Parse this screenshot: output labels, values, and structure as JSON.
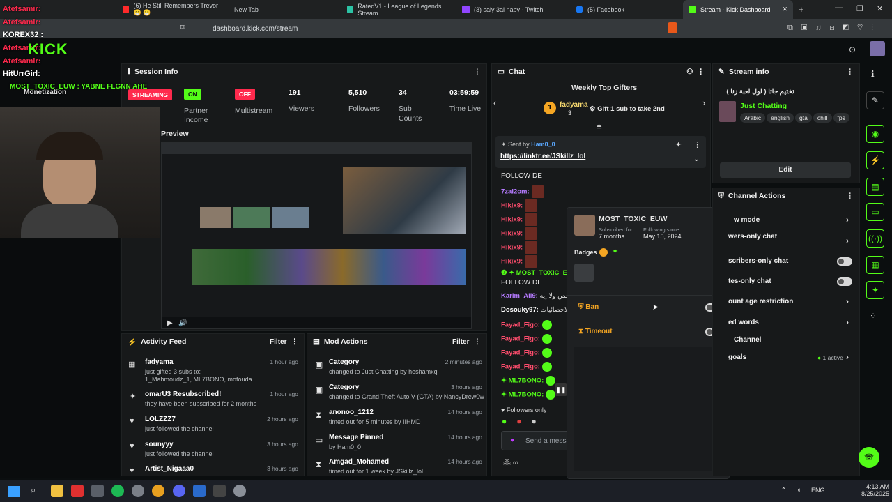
{
  "browser": {
    "tabs": [
      {
        "label": "(6) He Still Remembers Trevor 😁 😁",
        "color": "#ff2a2a"
      },
      {
        "label": "New Tab",
        "color": "#1f2122"
      },
      {
        "label": "RatedV1 - League of Legends Stream",
        "color": "#2cc3a5"
      },
      {
        "label": "(3) saly 3al naby - Twitch",
        "color": "#9146ff"
      },
      {
        "label": "(5) Facebook",
        "color": "#1877f2"
      },
      {
        "label": "Stream - Kick Dashboard",
        "color": "#53fc18"
      }
    ],
    "url": "dashboard.kick.com/stream"
  },
  "overlay": {
    "names": [
      "Atefsamir:",
      "Atefsamir:",
      "KOREX32 :",
      "Atefsamir:",
      "Atefsamir:",
      "HitUrrGirl:"
    ],
    "toxic": "MOST_TOXIC_EUW : YABNE FLGNN AHE",
    "monetization": "Monetization",
    "logo": "KICK"
  },
  "session": {
    "title": "Session Info",
    "streaming": "STREAMING",
    "on": "ON",
    "off": "OFF",
    "partner": "Partner Income",
    "multistream": "Multistream",
    "viewers": {
      "value": "191",
      "label": "Viewers"
    },
    "followers": {
      "value": "5,510",
      "label": "Followers"
    },
    "subs": {
      "value": "34",
      "label": "Sub Counts"
    },
    "time": {
      "value": "03:59:59",
      "label": "Time Live"
    },
    "preview": "Preview"
  },
  "activity": {
    "title": "Activity Feed",
    "filter": "Filter",
    "items": [
      {
        "name": "fadyama",
        "time": "1 hour ago",
        "text": "just gifted 3 subs to:",
        "text2": "1_Mahmoudz_1, ML7BONO, mofouda"
      },
      {
        "name": "omarU3 Resubscribed!",
        "time": "1 hour ago",
        "text": "they have been subscribed for 2 months",
        "text2": ""
      },
      {
        "name": "LOLZZZ7",
        "time": "2 hours ago",
        "text": "just followed the channel",
        "text2": ""
      },
      {
        "name": "sounyyy",
        "time": "3 hours ago",
        "text": "just followed the channel",
        "text2": ""
      },
      {
        "name": "Artist_Nigaaa0",
        "time": "3 hours ago",
        "text": "",
        "text2": ""
      }
    ]
  },
  "mod": {
    "title": "Mod Actions",
    "filter": "Filter",
    "items": [
      {
        "name": "Category",
        "time": "2 minutes ago",
        "text": "changed to Just Chatting by heshamxq"
      },
      {
        "name": "Category",
        "time": "3 hours ago",
        "text": "changed to Grand Theft Auto V (GTA) by NancyDrew0w"
      },
      {
        "name": "anonoo_1212",
        "time": "14 hours ago",
        "text": "timed out for 5 minutes by IIHMD"
      },
      {
        "name": "Message Pinned",
        "time": "14 hours ago",
        "text": "by Ham0_0"
      },
      {
        "name": "Amgad_Mohamed",
        "time": "14 hours ago",
        "text": "timed out for 1 week by JSkillz_lol"
      }
    ]
  },
  "chat": {
    "title": "Chat",
    "gifters_title": "Weekly Top Gifters",
    "gifter": {
      "name": "fadyama",
      "count": "3",
      "cta": "Gift 1 sub to take 2nd"
    },
    "pinned": {
      "sent_by": "Sent by",
      "user": "Ham0_0",
      "link": "https://linktr.ee/JSkillz_lol",
      "follow": "FOLLOW DE"
    },
    "lines": [
      {
        "user": "7zal2om:",
        "color": "#b57bff"
      },
      {
        "user": "Hikix9:",
        "color": "#ff4d6d"
      },
      {
        "user": "Hikix9:",
        "color": "#ff4d6d"
      },
      {
        "user": "Hikix9:",
        "color": "#ff4d6d"
      },
      {
        "user": "Hikix9:",
        "color": "#ff4d6d"
      },
      {
        "user": "Hikix9:",
        "color": "#ff4d6d"
      }
    ],
    "toxic_line": "MOST_TOXIC_E",
    "follow_de": "FOLLOW DE",
    "lines2": [
      {
        "user": "Karim_Ali9:",
        "text": "لو بعض ولا إيه",
        "color": "#b57bff"
      },
      {
        "user": "Dosouky97:",
        "text": "كرة الاحصائيات",
        "color": "#ffffff"
      },
      {
        "user": "Fayad_Figo:",
        "text": "",
        "color": "#ff4d6d"
      },
      {
        "user": "Fayad_Figo:",
        "text": "",
        "color": "#ff4d6d"
      },
      {
        "user": "Fayad_Figo:",
        "text": "",
        "color": "#ff4d6d"
      },
      {
        "user": "Fayad_Figo:",
        "text": "",
        "color": "#ff4d6d"
      },
      {
        "user": "ML7BONO:",
        "text": "",
        "color": "#53fc18"
      },
      {
        "user": "ML7BONO:",
        "text": "",
        "color": "#53fc18"
      }
    ],
    "followers_only": "Followers only",
    "placeholder": "Send a messa"
  },
  "usercard": {
    "name": "MOST_TOXIC_EUW",
    "sub_label": "Subscribed for",
    "sub_value": "7 months",
    "follow_label": "Following since",
    "follow_value": "May 15, 2024",
    "badges": "Badges",
    "ban": "Ban",
    "timeout": "Timeout"
  },
  "streaminfo": {
    "title": "Stream info",
    "stream_title": "تختيم جاتا ( لول لعبة زنا )",
    "category": "Just Chatting",
    "tags": [
      "Arabic",
      "english",
      "gta",
      "chill",
      "fps"
    ],
    "edit": "Edit"
  },
  "actions": {
    "title": "Channel Actions",
    "items": [
      {
        "label": "w mode",
        "type": "chev"
      },
      {
        "label": "wers-only chat",
        "type": "chev"
      },
      {
        "label": "scribers-only chat",
        "type": "toggle"
      },
      {
        "label": "tes-only chat",
        "type": "toggle"
      },
      {
        "label": "ount age restriction",
        "type": "chev"
      },
      {
        "label": "ed words",
        "type": "chev"
      },
      {
        "label": "Channel",
        "type": "none"
      },
      {
        "label": "goals",
        "type": "goals"
      }
    ],
    "goals_active": "1 active"
  },
  "taskbar": {
    "lang": "ENG",
    "time": "4:13 AM",
    "date": "8/25/2025"
  },
  "colors": {
    "accent": "#53fc18",
    "danger": "#ff2a4d",
    "panel": "#17191a"
  }
}
